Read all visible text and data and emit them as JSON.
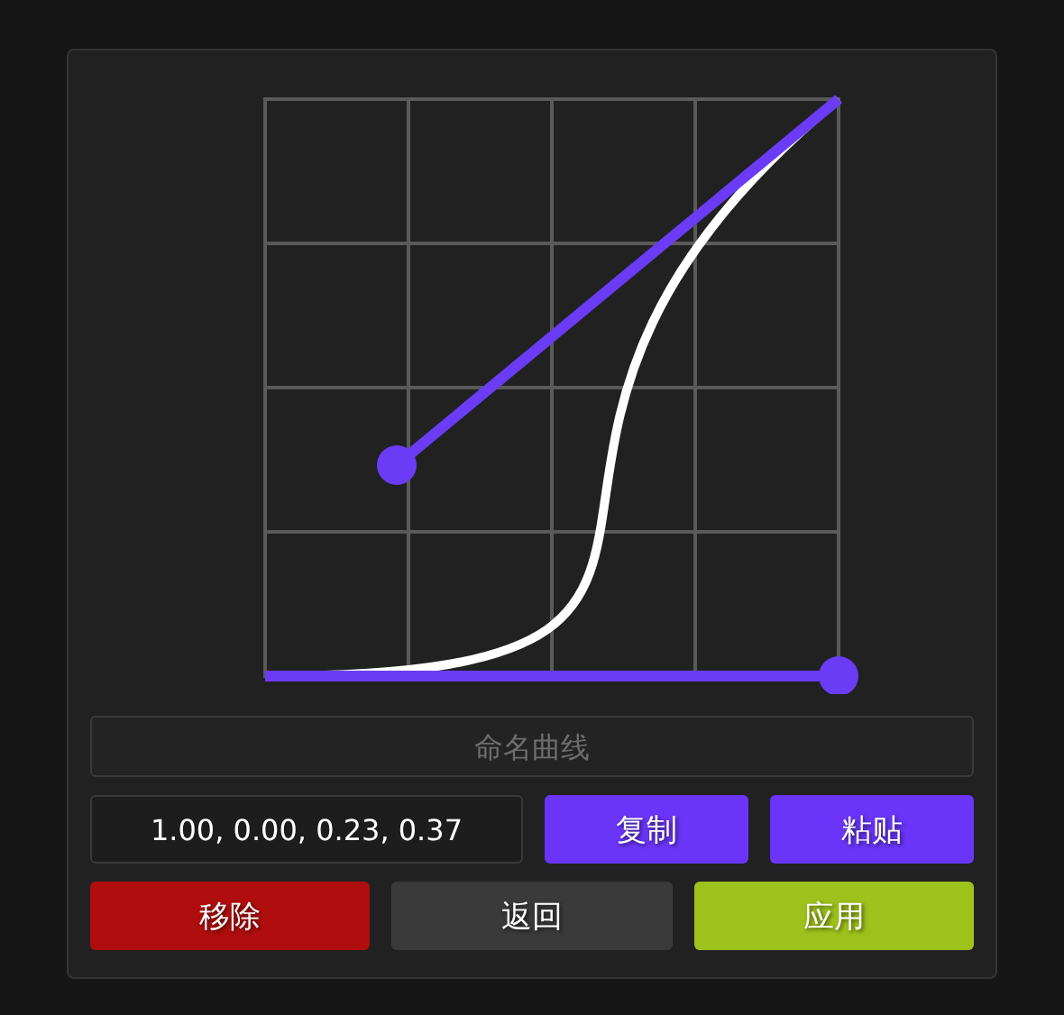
{
  "curve_name_field": {
    "placeholder": "命名曲线"
  },
  "curve_values": "1.00, 0.00, 0.23, 0.37",
  "value_buttons": [
    {
      "label": "复制",
      "kind": "accent"
    },
    {
      "label": "粘贴",
      "kind": "accent"
    }
  ],
  "action_buttons": [
    {
      "label": "移除",
      "kind": "danger"
    },
    {
      "label": "返回",
      "kind": "neutral"
    },
    {
      "label": "应用",
      "kind": "confirm"
    }
  ]
}
